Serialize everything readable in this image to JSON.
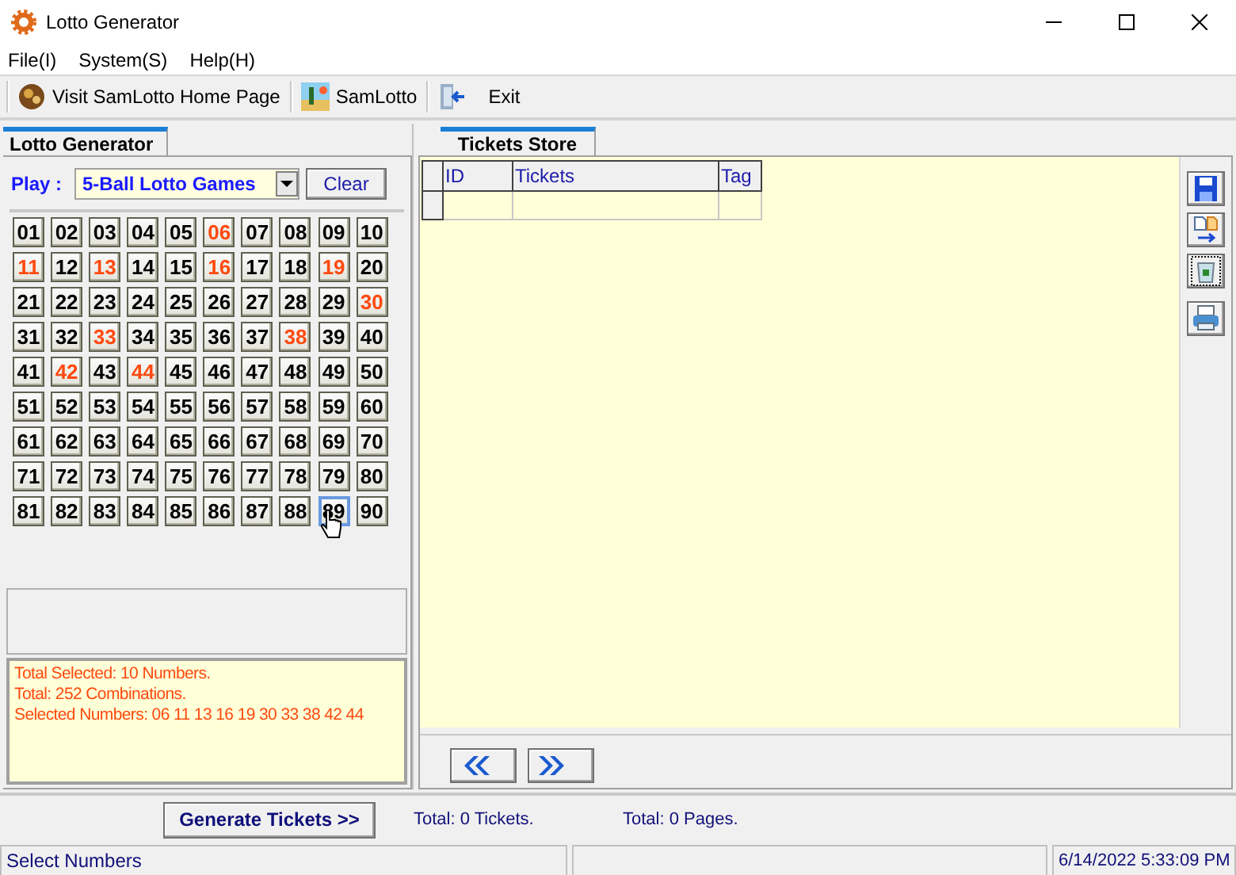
{
  "window": {
    "title": "Lotto Generator"
  },
  "menu": [
    "File(I)",
    "System(S)",
    "Help(H)"
  ],
  "toolbar": [
    {
      "kind": "globe",
      "label": "Visit SamLotto Home Page"
    },
    {
      "kind": "desert",
      "label": "SamLotto"
    },
    {
      "kind": "exit",
      "label": "Exit"
    }
  ],
  "left_panel": {
    "tab": "Lotto Generator",
    "play_label": "Play :",
    "game": "5-Ball Lotto Games",
    "clear_button": "Clear",
    "numbers": [
      {
        "label": "01",
        "selected": false,
        "focused": false
      },
      {
        "label": "02",
        "selected": false,
        "focused": false
      },
      {
        "label": "03",
        "selected": false,
        "focused": false
      },
      {
        "label": "04",
        "selected": false,
        "focused": false
      },
      {
        "label": "05",
        "selected": false,
        "focused": false
      },
      {
        "label": "06",
        "selected": true,
        "focused": false
      },
      {
        "label": "07",
        "selected": false,
        "focused": false
      },
      {
        "label": "08",
        "selected": false,
        "focused": false
      },
      {
        "label": "09",
        "selected": false,
        "focused": false
      },
      {
        "label": "10",
        "selected": false,
        "focused": false
      },
      {
        "label": "11",
        "selected": true,
        "focused": false
      },
      {
        "label": "12",
        "selected": false,
        "focused": false
      },
      {
        "label": "13",
        "selected": true,
        "focused": false
      },
      {
        "label": "14",
        "selected": false,
        "focused": false
      },
      {
        "label": "15",
        "selected": false,
        "focused": false
      },
      {
        "label": "16",
        "selected": true,
        "focused": false
      },
      {
        "label": "17",
        "selected": false,
        "focused": false
      },
      {
        "label": "18",
        "selected": false,
        "focused": false
      },
      {
        "label": "19",
        "selected": true,
        "focused": false
      },
      {
        "label": "20",
        "selected": false,
        "focused": false
      },
      {
        "label": "21",
        "selected": false,
        "focused": false
      },
      {
        "label": "22",
        "selected": false,
        "focused": false
      },
      {
        "label": "23",
        "selected": false,
        "focused": false
      },
      {
        "label": "24",
        "selected": false,
        "focused": false
      },
      {
        "label": "25",
        "selected": false,
        "focused": false
      },
      {
        "label": "26",
        "selected": false,
        "focused": false
      },
      {
        "label": "27",
        "selected": false,
        "focused": false
      },
      {
        "label": "28",
        "selected": false,
        "focused": false
      },
      {
        "label": "29",
        "selected": false,
        "focused": false
      },
      {
        "label": "30",
        "selected": true,
        "focused": false
      },
      {
        "label": "31",
        "selected": false,
        "focused": false
      },
      {
        "label": "32",
        "selected": false,
        "focused": false
      },
      {
        "label": "33",
        "selected": true,
        "focused": false
      },
      {
        "label": "34",
        "selected": false,
        "focused": false
      },
      {
        "label": "35",
        "selected": false,
        "focused": false
      },
      {
        "label": "36",
        "selected": false,
        "focused": false
      },
      {
        "label": "37",
        "selected": false,
        "focused": false
      },
      {
        "label": "38",
        "selected": true,
        "focused": false
      },
      {
        "label": "39",
        "selected": false,
        "focused": false
      },
      {
        "label": "40",
        "selected": false,
        "focused": false
      },
      {
        "label": "41",
        "selected": false,
        "focused": false
      },
      {
        "label": "42",
        "selected": true,
        "focused": false
      },
      {
        "label": "43",
        "selected": false,
        "focused": false
      },
      {
        "label": "44",
        "selected": true,
        "focused": false
      },
      {
        "label": "45",
        "selected": false,
        "focused": false
      },
      {
        "label": "46",
        "selected": false,
        "focused": false
      },
      {
        "label": "47",
        "selected": false,
        "focused": false
      },
      {
        "label": "48",
        "selected": false,
        "focused": false
      },
      {
        "label": "49",
        "selected": false,
        "focused": false
      },
      {
        "label": "50",
        "selected": false,
        "focused": false
      },
      {
        "label": "51",
        "selected": false,
        "focused": false
      },
      {
        "label": "52",
        "selected": false,
        "focused": false
      },
      {
        "label": "53",
        "selected": false,
        "focused": false
      },
      {
        "label": "54",
        "selected": false,
        "focused": false
      },
      {
        "label": "55",
        "selected": false,
        "focused": false
      },
      {
        "label": "56",
        "selected": false,
        "focused": false
      },
      {
        "label": "57",
        "selected": false,
        "focused": false
      },
      {
        "label": "58",
        "selected": false,
        "focused": false
      },
      {
        "label": "59",
        "selected": false,
        "focused": false
      },
      {
        "label": "60",
        "selected": false,
        "focused": false
      },
      {
        "label": "61",
        "selected": false,
        "focused": false
      },
      {
        "label": "62",
        "selected": false,
        "focused": false
      },
      {
        "label": "63",
        "selected": false,
        "focused": false
      },
      {
        "label": "64",
        "selected": false,
        "focused": false
      },
      {
        "label": "65",
        "selected": false,
        "focused": false
      },
      {
        "label": "66",
        "selected": false,
        "focused": false
      },
      {
        "label": "67",
        "selected": false,
        "focused": false
      },
      {
        "label": "68",
        "selected": false,
        "focused": false
      },
      {
        "label": "69",
        "selected": false,
        "focused": false
      },
      {
        "label": "70",
        "selected": false,
        "focused": false
      },
      {
        "label": "71",
        "selected": false,
        "focused": false
      },
      {
        "label": "72",
        "selected": false,
        "focused": false
      },
      {
        "label": "73",
        "selected": false,
        "focused": false
      },
      {
        "label": "74",
        "selected": false,
        "focused": false
      },
      {
        "label": "75",
        "selected": false,
        "focused": false
      },
      {
        "label": "76",
        "selected": false,
        "focused": false
      },
      {
        "label": "77",
        "selected": false,
        "focused": false
      },
      {
        "label": "78",
        "selected": false,
        "focused": false
      },
      {
        "label": "79",
        "selected": false,
        "focused": false
      },
      {
        "label": "80",
        "selected": false,
        "focused": false
      },
      {
        "label": "81",
        "selected": false,
        "focused": false
      },
      {
        "label": "82",
        "selected": false,
        "focused": false
      },
      {
        "label": "83",
        "selected": false,
        "focused": false
      },
      {
        "label": "84",
        "selected": false,
        "focused": false
      },
      {
        "label": "85",
        "selected": false,
        "focused": false
      },
      {
        "label": "86",
        "selected": false,
        "focused": false
      },
      {
        "label": "87",
        "selected": false,
        "focused": false
      },
      {
        "label": "88",
        "selected": false,
        "focused": false
      },
      {
        "label": "89",
        "selected": false,
        "focused": true
      },
      {
        "label": "90",
        "selected": false,
        "focused": false
      }
    ],
    "info": [
      "Total Selected: 10 Numbers.",
      "Total: 252 Combinations.",
      "Selected Numbers: 06 11 13 16 19 30 33 38 42 44"
    ]
  },
  "right_panel": {
    "tab": "Tickets Store",
    "table": {
      "columns": [
        "ID",
        "Tickets",
        "Tag"
      ]
    },
    "side_buttons": [
      {
        "kind": "save"
      },
      {
        "kind": "copy"
      },
      {
        "kind": "recycle"
      },
      {
        "kind": "print"
      }
    ]
  },
  "bottom": {
    "generate_button": "Generate Tickets >>",
    "tickets_total": "Total: 0 Tickets.",
    "pages_total": "Total: 0 Pages."
  },
  "status_bar": [
    "Select Numbers",
    "6/14/2022 5:33:09 PM"
  ]
}
